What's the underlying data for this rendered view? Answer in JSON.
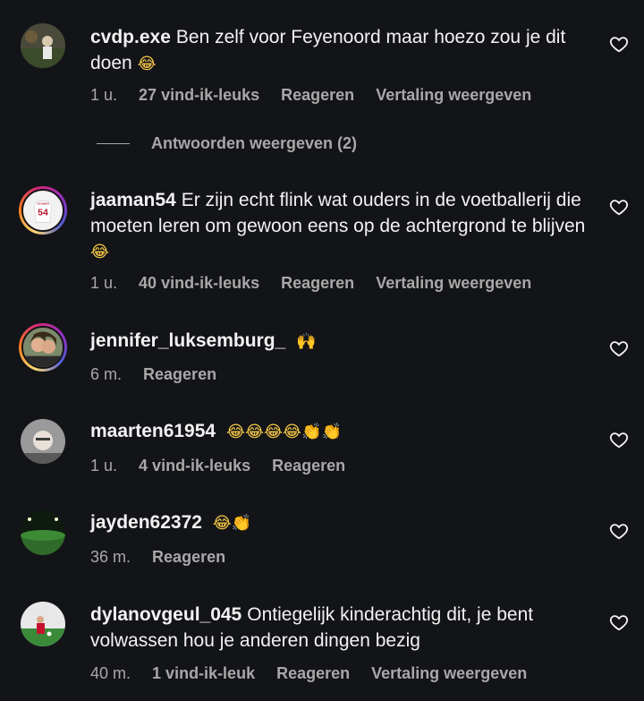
{
  "comments": [
    {
      "username": "cvdp.exe",
      "text": "Ben zelf voor Feyenoord maar hoezo zou je dit doen",
      "emojis": "😂",
      "time": "1 u.",
      "likes": "27 vind-ik-leuks",
      "reply": "Reageren",
      "translate": "Vertaling weergeven"
    },
    {
      "username": "jaaman54",
      "text": "Er zijn echt flink wat ouders in de voetballerij die moeten leren om gewoon eens op de achtergrond te blijven",
      "emojis": "😂",
      "time": "1 u.",
      "likes": "40 vind-ik-leuks",
      "reply": "Reageren",
      "translate": "Vertaling weergeven",
      "avatar_number": "54",
      "avatar_name": "JAAMAN"
    },
    {
      "username": "jennifer_luksemburg_",
      "text": "",
      "emojis": "🙌",
      "time": "6 m.",
      "reply": "Reageren"
    },
    {
      "username": "maarten61954",
      "text": "",
      "emojis": "😂😂😂😂👏👏",
      "time": "1 u.",
      "likes": "4 vind-ik-leuks",
      "reply": "Reageren"
    },
    {
      "username": "jayden62372",
      "text": "",
      "emojis": "😂👏",
      "time": "36 m.",
      "reply": "Reageren"
    },
    {
      "username": "dylanovgeul_045",
      "text": "Ontiegelijk kinderachtig dit, je bent volwassen hou je anderen dingen bezig",
      "emojis": "",
      "time": "40 m.",
      "likes": "1 vind-ik-leuk",
      "reply": "Reageren",
      "translate": "Vertaling weergeven"
    }
  ],
  "view_replies": "Antwoorden weergeven (2)",
  "icons": {
    "like": "heart-outline-icon"
  },
  "colors": {
    "background": "#131418",
    "text": "#f2f2f2",
    "secondary": "#a8a8a8"
  }
}
